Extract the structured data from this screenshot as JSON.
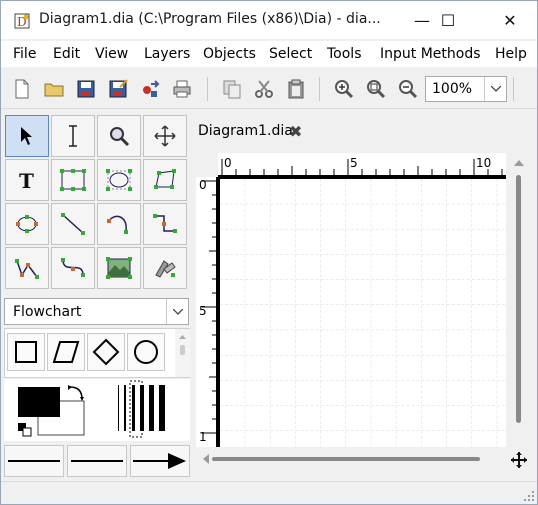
{
  "window": {
    "title": "Diagram1.dia (C:\\Program Files (x86)\\Dia) - dia...",
    "min_glyph": "—",
    "max_glyph": "☐",
    "close_glyph": "✕"
  },
  "menu": [
    {
      "key": "file",
      "label": "File"
    },
    {
      "key": "edit",
      "label": "Edit"
    },
    {
      "key": "view",
      "label": "View"
    },
    {
      "key": "layers",
      "label": "Layers"
    },
    {
      "key": "objects",
      "label": "Objects"
    },
    {
      "key": "select",
      "label": "Select"
    },
    {
      "key": "tools",
      "label": "Tools"
    },
    {
      "key": "input",
      "label": "Input Methods"
    },
    {
      "key": "help",
      "label": "Help"
    }
  ],
  "toolbar": {
    "zoom_value": "100%",
    "icons": [
      "new-file-icon",
      "open-folder-icon",
      "save-icon",
      "save-as-icon",
      "export-icon",
      "print-icon",
      "copy-icon",
      "cut-icon",
      "paste-icon",
      "zoom-in-icon",
      "zoom-fit-icon",
      "zoom-out-icon"
    ]
  },
  "toolbox": {
    "sheet": "Flowchart",
    "tools": [
      "pointer",
      "text-edit",
      "magnify",
      "scroll",
      "text",
      "box",
      "ellipse",
      "polygon",
      "beziergon",
      "line",
      "arc",
      "zigzag",
      "polyline",
      "bezierline",
      "image",
      "outline"
    ]
  },
  "tab": {
    "label": "Diagram1.dia",
    "close_glyph": "✖"
  },
  "ruler": {
    "h_labels": [
      "0",
      "5",
      "10"
    ],
    "v_labels": [
      "0",
      "5",
      "1"
    ]
  },
  "colors": {
    "accent": "#5b86c4",
    "grid": "#cfd8e6",
    "foreground": "#000000",
    "background": "#ffffff"
  }
}
